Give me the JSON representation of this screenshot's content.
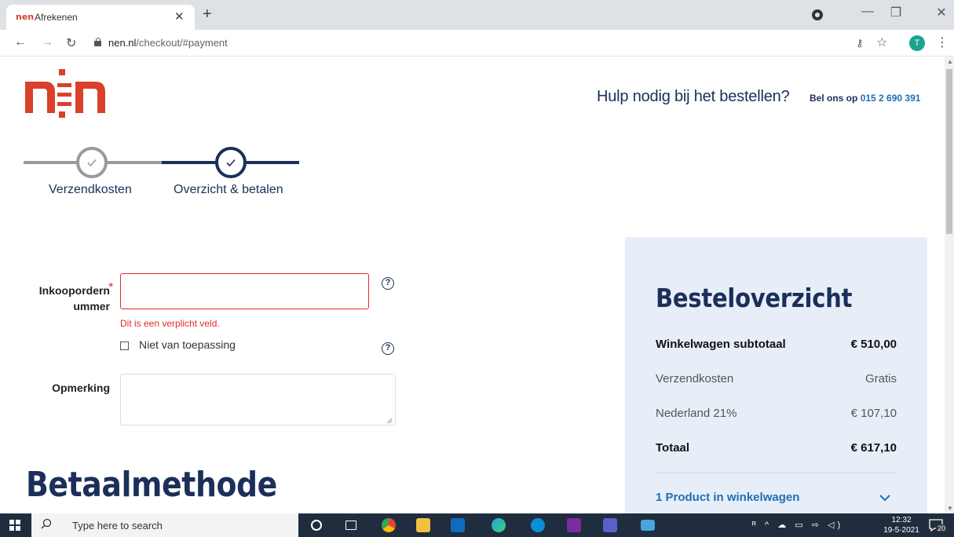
{
  "browser": {
    "tab_title": "Afrekenen",
    "tab_favicon_text": "nen",
    "url_host": "nen.nl",
    "url_path": "/checkout/#payment",
    "profile_initial": "T"
  },
  "header": {
    "help_text": "Hulp nodig bij het bestellen?",
    "call_prefix": "Bel ons op",
    "phone": "015 2 690 391"
  },
  "steps": [
    {
      "label": "Verzendkosten"
    },
    {
      "label": "Overzicht & betalen"
    }
  ],
  "form": {
    "po_label": "Inkoopordernummer",
    "po_label_line1": "Inkoopordern",
    "po_label_line2": "ummer",
    "po_required_mark": "*",
    "po_value": "",
    "po_error": "Dit is een verplicht veld.",
    "not_applicable_label": "Niet van toepassing",
    "remark_label": "Opmerking",
    "remark_value": "",
    "help_glyph": "?"
  },
  "payment": {
    "title": "Betaalmethode"
  },
  "summary": {
    "title": "Besteloverzicht",
    "rows": [
      {
        "label": "Winkelwagen subtotaal",
        "value": "€ 510,00"
      },
      {
        "label": "Verzendkosten",
        "value": "Gratis"
      },
      {
        "label": "Nederland 21%",
        "value": "€ 107,10"
      },
      {
        "label": "Totaal",
        "value": "€ 617,10"
      }
    ],
    "products_link": "1 Product in winkelwagen"
  },
  "taskbar": {
    "search_placeholder": "Type here to search",
    "time": "12:32",
    "date": "19-5-2021",
    "notification_count": "20"
  },
  "colors": {
    "brand_red": "#d9412a",
    "navy": "#1b2f5a",
    "link_blue": "#1f6fb5",
    "error_red": "#e02b27",
    "summary_bg": "#e7eef8"
  },
  "icons": [
    "close-icon",
    "plus-icon",
    "back-arrow-icon",
    "forward-arrow-icon",
    "reload-icon",
    "lock-icon",
    "key-icon",
    "star-icon",
    "kebab-menu-icon",
    "check-icon",
    "help-circle-icon",
    "chevron-down-icon",
    "windows-start-icon",
    "search-icon"
  ]
}
